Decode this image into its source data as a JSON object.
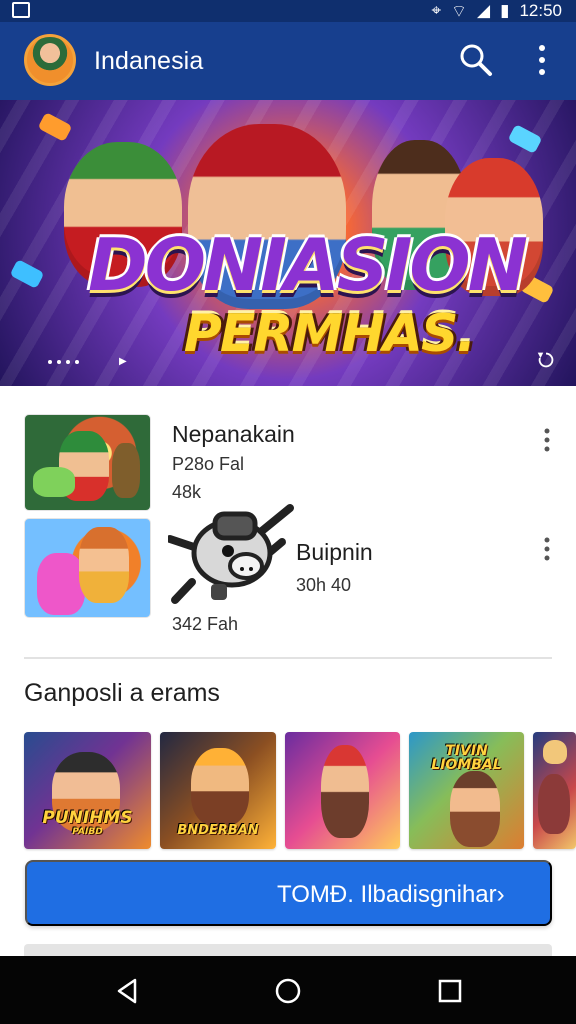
{
  "status_bar": {
    "time": "12:50"
  },
  "app_bar": {
    "title": "Indanesia",
    "search_icon": "search-icon",
    "more_icon": "more-vert-icon"
  },
  "hero": {
    "title": "DONIASION",
    "subtitle": "PERMHAS."
  },
  "items": [
    {
      "title": "Nepanakain",
      "subtitle": "P28o Fal",
      "meta": "48k"
    },
    {
      "title": "Buipnin",
      "subtitle": "30h 40",
      "meta": "342 Fah"
    }
  ],
  "section": {
    "title": "Ganposli a erams"
  },
  "games": [
    {
      "label": "PUNIHMS",
      "caption": "PAIBD"
    },
    {
      "label": "BNDERBAN"
    },
    {
      "label": ""
    },
    {
      "label": "TIVIN LIOMBAL"
    },
    {
      "label": ""
    }
  ],
  "cta": {
    "label": "TOMÐ. Ilbadisgnihar›"
  },
  "colors": {
    "app_bar": "#173f8e",
    "accent_button": "#1f6ee3",
    "status_bar": "#0f2f6e",
    "nav_bar": "#050505"
  }
}
